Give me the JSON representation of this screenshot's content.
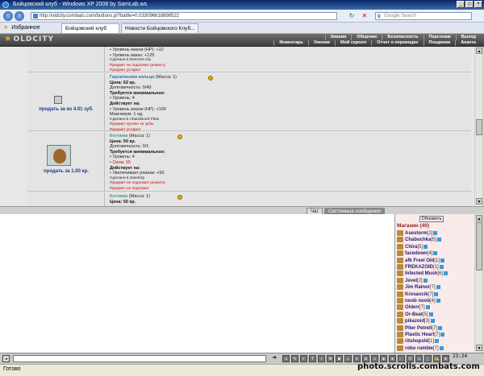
{
  "window": {
    "title": "Бойцовский клуб - Windows XP 2008 by SamLab.ws"
  },
  "browser": {
    "url": "http://oldcity.combats.com/buttons.pl?battle=0.033096618898522",
    "search_placeholder": "Google Search",
    "favorites_label": "Избранное",
    "tabs": [
      {
        "label": "Бойцовский клуб"
      },
      {
        "label": "Новости Бойцовского Клуб..."
      }
    ]
  },
  "header": {
    "logo": "OLDCITY",
    "menu_top": [
      "Знания",
      "Общение",
      "Безопасность",
      "Персонаж",
      "Выход"
    ],
    "menu_bottom": [
      "Инвентарь",
      "Умения",
      "Мой скролл",
      "Отчет о переводах",
      "Поединки",
      "Анкета"
    ]
  },
  "items": [
    {
      "lines_top": [
        "• Уровень жизни (HP): +12",
        "• Уровень маны: +125",
        "Сделано в Demons city"
      ],
      "red_lines": [
        "Предмет не подлежит ремонту",
        "Предмет устарел"
      ]
    },
    {
      "sell_label": "продать за из 4.01 зуб.",
      "name": "Героическое кольцо",
      "mass": "(Масса: 1)",
      "price": "Цена: 62 кр.",
      "durability": "Долговечность: 0/49",
      "req_title": "Требуется минимальное:",
      "req_lines": [
        "• Уровень: 4"
      ],
      "acts_title": "Действует на:",
      "act_lines": [
        "• Уровень жизни (HP): +100"
      ],
      "max_line": "Максимум: 1 ед.",
      "made_in": "Сделано в Abandoned Plain",
      "red_lines": [
        "Предмет куплен за зубы",
        "Предмет устарел"
      ]
    },
    {
      "sell_label": "продать за 1.00 кр.",
      "name": "Котомка",
      "mass": "(Масса: 1)",
      "price": "Цена: 50 кр.",
      "durability": "Долговечность: 0/1",
      "req_title": "Требуется минимальное:",
      "req_lines": [
        "• Уровень: 4"
      ],
      "req_red": "• Сила: 15",
      "acts_title": "Действует на:",
      "act_lines": [
        "• Увеличивает рюкзак: +50"
      ],
      "made_in": "Сделано в Sandcity",
      "red_lines": [
        "Предмет не подлежит ремонту",
        "Предмет не подлежит"
      ]
    },
    {
      "name": "Котомка",
      "mass": "(Масса: 1)",
      "price": "Цена: 50 кр."
    }
  ],
  "chat": {
    "tab_chat": "Чат",
    "tab_system": "Системные сообщения"
  },
  "online": {
    "refresh_label": "Обновить",
    "room_label": "Магазин (40)",
    "players": [
      {
        "name": "Asestorm",
        "level": "[1]"
      },
      {
        "name": "Chabochka",
        "level": "[5]"
      },
      {
        "name": "Chira",
        "level": "[5]"
      },
      {
        "name": "facedown",
        "level": "[4]"
      },
      {
        "name": "afk Freel Old",
        "level": "[1]"
      },
      {
        "name": "FREKAZOID",
        "level": "[1]"
      },
      {
        "name": "Infected Mush",
        "level": "[6]"
      },
      {
        "name": "Jevel",
        "level": "[2]"
      },
      {
        "name": "Jim Rainor",
        "level": "[7]"
      },
      {
        "name": "Krosavcik",
        "level": "[7]"
      },
      {
        "name": "noob noob",
        "level": "[4]"
      },
      {
        "name": "Olderr",
        "level": "[7]"
      },
      {
        "name": "Or-Beat",
        "level": "[5]"
      },
      {
        "name": "pikazoid",
        "level": "[3]"
      },
      {
        "name": "Piter Petrell",
        "level": "[7]"
      },
      {
        "name": "Plastic Heart",
        "level": "[7]"
      },
      {
        "name": "ritshopold",
        "level": "[1]"
      },
      {
        "name": "robo rumble",
        "level": "[7]"
      }
    ]
  },
  "footer": {
    "clock": "23:24",
    "status": "Готово",
    "watermark": "photo.scrolls.combats.com"
  }
}
